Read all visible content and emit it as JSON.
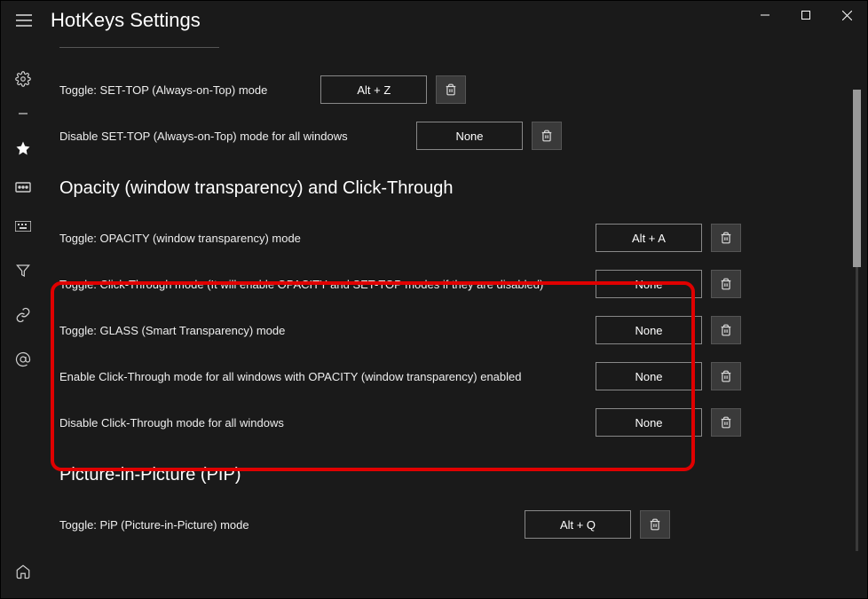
{
  "title": "HotKeys Settings",
  "rows": {
    "r1": {
      "label": "Toggle: SET-TOP (Always-on-Top) mode",
      "hotkey": "Alt + Z"
    },
    "r2": {
      "label": "Disable SET-TOP (Always-on-Top) mode for all windows",
      "hotkey": "None"
    }
  },
  "section2": "Opacity (window transparency) and Click-Through",
  "s2rows": {
    "r1": {
      "label": "Toggle: OPACITY (window transparency) mode",
      "hotkey": "Alt + A"
    },
    "r2": {
      "label": "Toggle: Click-Through mode (It will enable OPACITY and SET-TOP modes if they are disabled)",
      "hotkey": "None"
    },
    "r3": {
      "label": "Toggle: GLASS (Smart Transparency) mode",
      "hotkey": "None"
    },
    "r4": {
      "label": "Enable Click-Through mode for all windows with OPACITY (window transparency) enabled",
      "hotkey": "None"
    },
    "r5": {
      "label": "Disable Click-Through mode for all windows",
      "hotkey": "None"
    }
  },
  "section3": "Picture-in-Picture (PIP)",
  "s3rows": {
    "r1": {
      "label": "Toggle: PiP (Picture-in-Picture) mode",
      "hotkey": "Alt + Q"
    }
  },
  "sidebar": {
    "items": [
      "settings",
      "favorite",
      "keyboard",
      "keyboard2",
      "filter",
      "link",
      "at",
      "home"
    ]
  }
}
